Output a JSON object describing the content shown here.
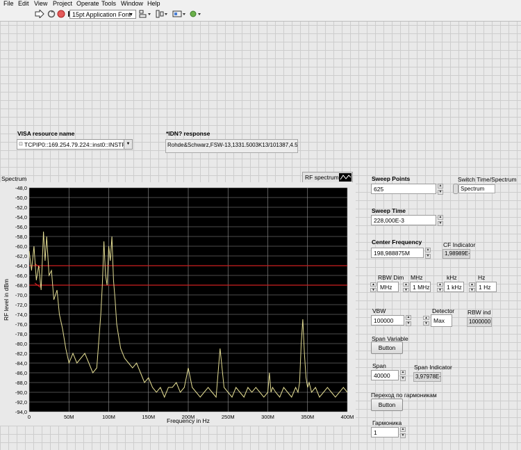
{
  "menu": [
    "File",
    "Edit",
    "View",
    "Project",
    "Operate",
    "Tools",
    "Window",
    "Help"
  ],
  "toolbar": {
    "font_select": "15pt Application Font"
  },
  "visa": {
    "label": "VISA resource name",
    "value": "TCPIP0::169.254.79.224::inst0::INSTR"
  },
  "idn": {
    "label": "*IDN? response",
    "value": "Rohde&Schwarz,FSW-13,1331.5003K13/101387,4.51"
  },
  "spectrum": {
    "label": "Spectrum",
    "legend": "RF spectrum"
  },
  "sweep_points": {
    "label": "Sweep Points",
    "value": "625"
  },
  "switch": {
    "label": "Switch Time/Spectrum",
    "value": "Spectrum"
  },
  "sweep_time": {
    "label": "Sweep Time",
    "value": "228,000E-3"
  },
  "center_freq": {
    "label": "Center Frequency",
    "value": "198,988875M"
  },
  "cf_indicator": {
    "label": "CF Indicator",
    "value": "1,98989E+"
  },
  "rbw": {
    "dim_label": "RBW Dim",
    "dim_value": "MHz",
    "mhz_label": "MHz",
    "mhz_value": "1 MHz",
    "khz_label": "kHz",
    "khz_value": "1 kHz",
    "hz_label": "Hz",
    "hz_value": "1 Hz"
  },
  "vbw": {
    "label": "VBW",
    "value": "100000"
  },
  "detector": {
    "label": "Detector",
    "value": "Max"
  },
  "rbw_ind": {
    "label": "RBW ind",
    "value": "1000000"
  },
  "span_variable": {
    "label": "Span Variable",
    "button": "Button"
  },
  "span": {
    "label": "Span",
    "value": "40000"
  },
  "span_indicator": {
    "label": "Span Indicator",
    "value": "3,97978E+"
  },
  "harmonic_nav": {
    "label": "Переход по гармоникам",
    "button": "Button"
  },
  "harmonic": {
    "label": "Гармоника",
    "value": "1"
  },
  "chart_data": {
    "type": "line",
    "xlabel": "Frequency in Hz",
    "ylabel": "RF level in dBm",
    "xlim": [
      0,
      400000000
    ],
    "ylim": [
      -94,
      -48
    ],
    "xticks": [
      "0",
      "50M",
      "100M",
      "150M",
      "200M",
      "250M",
      "300M",
      "350M",
      "400M"
    ],
    "yticks": [
      "-48,0",
      "-50,0",
      "-52,0",
      "-54,0",
      "-56,0",
      "-58,0",
      "-60,0",
      "-62,0",
      "-64,0",
      "-66,0",
      "-68,0",
      "-70,0",
      "-72,0",
      "-74,0",
      "-76,0",
      "-78,0",
      "-80,0",
      "-82,0",
      "-84,0",
      "-86,0",
      "-88,0",
      "-90,0",
      "-92,0",
      "-94,0"
    ],
    "grid": true,
    "background": "#000000",
    "series_color": "#e4dd93",
    "markers": [
      {
        "y": -64.0,
        "color": "#cc2020"
      },
      {
        "y": -68.0,
        "color": "#cc2020"
      }
    ],
    "series": [
      {
        "x": [
          0,
          3000000,
          6000000,
          9000000,
          12000000,
          15000000,
          18000000,
          20000000,
          22000000,
          25000000,
          28000000,
          31000000,
          35000000,
          38000000,
          42000000,
          46000000,
          50000000,
          55000000,
          60000000,
          65000000,
          70000000,
          75000000,
          80000000,
          85000000,
          90000000,
          92000000,
          94000000,
          96000000,
          98000000,
          100000000,
          102000000,
          104000000,
          106000000,
          108000000,
          110000000,
          112000000,
          115000000,
          120000000,
          125000000,
          130000000,
          135000000,
          140000000,
          145000000,
          150000000,
          155000000,
          160000000,
          165000000,
          170000000,
          175000000,
          180000000,
          185000000,
          190000000,
          195000000,
          200000000,
          205000000,
          210000000,
          215000000,
          220000000,
          225000000,
          230000000,
          235000000,
          240000000,
          245000000,
          250000000,
          255000000,
          260000000,
          265000000,
          270000000,
          275000000,
          280000000,
          285000000,
          290000000,
          295000000,
          300000000,
          302000000,
          304000000,
          306000000,
          310000000,
          315000000,
          320000000,
          325000000,
          330000000,
          335000000,
          338000000,
          340000000,
          342000000,
          344000000,
          346000000,
          348000000,
          350000000,
          352000000,
          355000000,
          360000000,
          365000000,
          370000000,
          375000000,
          380000000,
          385000000,
          390000000,
          395000000,
          400000000
        ],
        "y": [
          -61,
          -65,
          -60,
          -67,
          -64,
          -69,
          -57,
          -63,
          -58,
          -66,
          -65,
          -71,
          -69,
          -74,
          -77,
          -81,
          -84,
          -82,
          -84,
          -83,
          -82,
          -84,
          -86,
          -85,
          -74,
          -68,
          -59,
          -66,
          -68,
          -60,
          -63,
          -58,
          -67,
          -71,
          -76,
          -78,
          -81,
          -83,
          -84,
          -85,
          -84,
          -86,
          -88,
          -87,
          -89,
          -90,
          -89,
          -91,
          -89,
          -89,
          -88,
          -90,
          -89,
          -85,
          -89,
          -90,
          -91,
          -90,
          -89,
          -90,
          -91,
          -81,
          -89,
          -90,
          -91,
          -89,
          -90,
          -91,
          -89,
          -90,
          -89,
          -90,
          -91,
          -90,
          -86,
          -90,
          -89,
          -90,
          -91,
          -89,
          -90,
          -91,
          -89,
          -90,
          -88,
          -80,
          -75,
          -82,
          -87,
          -89,
          -88,
          -90,
          -89,
          -91,
          -90,
          -89,
          -90,
          -91,
          -90,
          -89,
          -90
        ]
      }
    ]
  }
}
